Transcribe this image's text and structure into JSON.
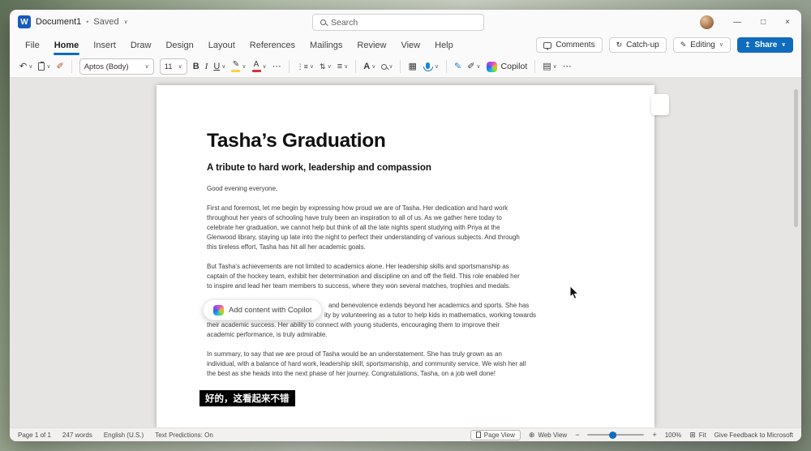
{
  "colors": {
    "accent": "#0f6cbd",
    "word_blue": "#185abd",
    "highlight_yellow": "#f7d44c",
    "font_color_red": "#d13438"
  },
  "titlebar": {
    "app_initial": "W",
    "doc_title": "Document1",
    "separator": "•",
    "saved_status": "Saved",
    "search_placeholder": "Search"
  },
  "ribbon": {
    "tabs": [
      "File",
      "Home",
      "Insert",
      "Draw",
      "Design",
      "Layout",
      "References",
      "Mailings",
      "Review",
      "View",
      "Help"
    ],
    "active_tab": "Home",
    "comments_label": "Comments",
    "catchup_label": "Catch-up",
    "editing_label": "Editing",
    "share_label": "Share"
  },
  "toolbar": {
    "font_name": "Aptos (Body)",
    "font_size": "11",
    "copilot_label": "Copilot"
  },
  "icons": {
    "chevron": "∨",
    "undo": "↶",
    "bold": "B",
    "italic": "I",
    "underline": "U",
    "highlight_glyph": "✎",
    "font_color_glyph": "A",
    "more": "⋯",
    "bullets": "⋮≡",
    "spacing": "⇅",
    "align": "≡",
    "styles": "A",
    "editor": "▦",
    "quill": "✎",
    "wand": "✐",
    "designer": "▤",
    "share": "↥",
    "catchup": "↻",
    "editing_pencil": "✎",
    "minimize": "—",
    "maximize": "□",
    "close": "×",
    "web_view": "⊕",
    "fit": "⊞",
    "zoom_out": "−",
    "zoom_in": "+"
  },
  "document": {
    "title": "Tasha’s Graduation",
    "subtitle": "A tribute to hard work, leadership and compassion",
    "copilot_button_label": "Add content with Copilot",
    "body": [
      [
        "Good evening everyone,"
      ],
      [
        "First and foremost, let me begin by expressing how proud we are of Tasha. Her dedication and hard work",
        "throughout her years of schooling have truly been an inspiration to all of us. As we gather here today to",
        "celebrate her graduation, we cannot help but think of all the late nights spent studying with Priya at the",
        "Glenwood library, staying up late into the night to perfect their understanding of various subjects. And through",
        "this tireless effort, Tasha has hit all her academic goals."
      ],
      [
        "But Tasha's achievements are not limited to academics alone. Her leadership skills and sportsmanship as",
        "captain of the hockey team, exhibit her determination and discipline on and off the field. This role enabled her",
        "to inspire and lead her team members to success, where they won several matches, trophies and medals."
      ],
      [
        "and benevolence extends beyond her academics and sports. She has",
        "ity by volunteering as a tutor to help kids in mathematics, working towards",
        "their academic success. Her ability to connect with young students, encouraging them to improve their",
        "academic performance, is truly admirable."
      ],
      [
        "In summary, to say that we are proud of Tasha would be an understatement. She has truly grown as an",
        "individual, with a balance of hard work, leadership skill, sportsmanship, and community service. We wish her all",
        "the best as she heads into the next phase of her journey. Congratulations, Tasha, on a job well done!"
      ]
    ]
  },
  "caption_overlay": {
    "text": "好的，这看起来不错"
  },
  "statusbar": {
    "page_count": "Page 1 of 1",
    "word_count": "247 words",
    "language": "English (U.S.)",
    "text_predictions": "Text Predictions: On",
    "page_view": "Page View",
    "web_view": "Web View",
    "zoom_level": "100%",
    "fit": "Fit",
    "feedback": "Give Feedback to Microsoft"
  }
}
